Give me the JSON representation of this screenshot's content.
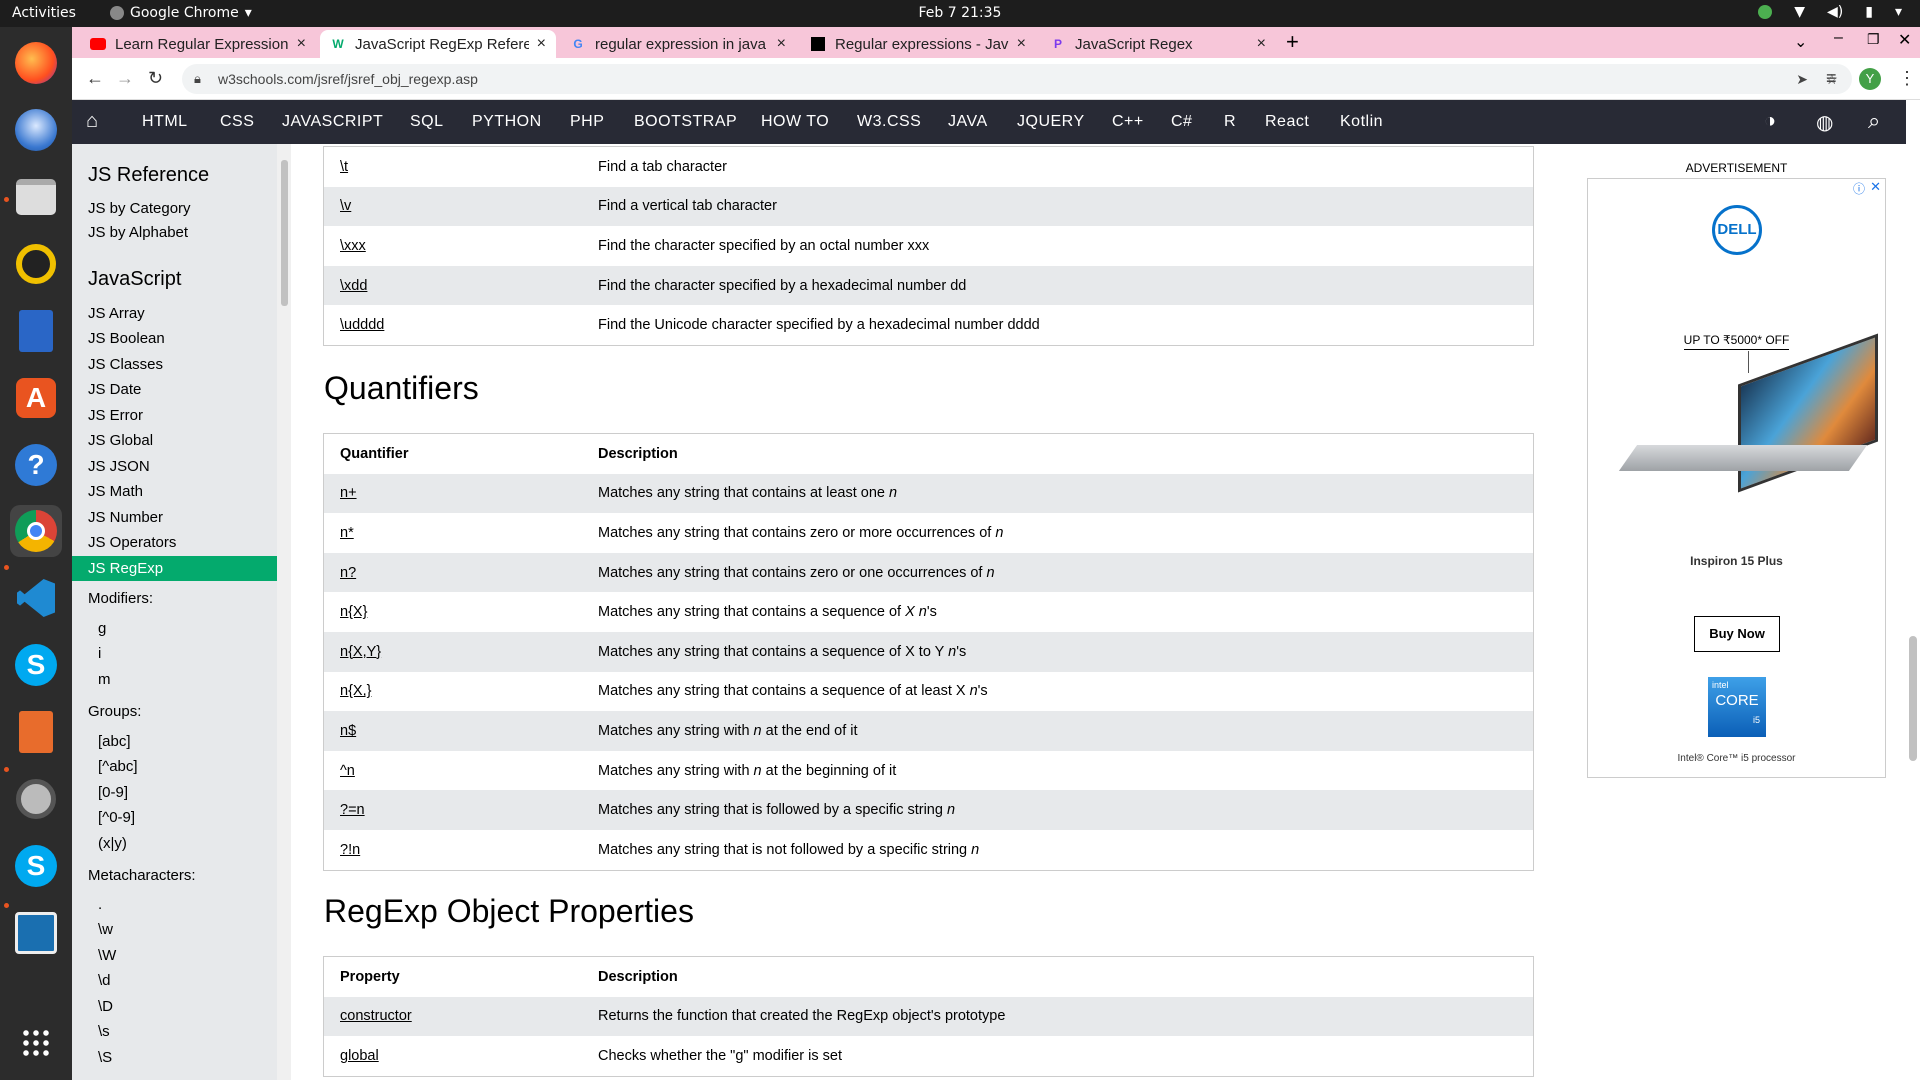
{
  "system": {
    "activities": "Activities",
    "app_name": "Google Chrome",
    "clock": "Feb 7  21:35"
  },
  "tabs": [
    {
      "label": "Learn Regular Expression",
      "icon": "youtube-icon",
      "color": "#ff0000"
    },
    {
      "label": "JavaScript RegExp Refere",
      "icon": "w3schools-icon",
      "color": "#04aa6d"
    },
    {
      "label": "regular expression in java",
      "icon": "google-icon",
      "color": "#4285f4"
    },
    {
      "label": "Regular expressions - Jav",
      "icon": "mdn-icon",
      "color": "#000000"
    },
    {
      "label": "JavaScript Regex",
      "icon": "programiz-icon",
      "color": "#7c3aed"
    }
  ],
  "address": {
    "url": "w3schools.com/jsref/jsref_obj_regexp.asp"
  },
  "w3nav": [
    "HTML",
    "CSS",
    "JAVASCRIPT",
    "SQL",
    "PYTHON",
    "PHP",
    "BOOTSTRAP",
    "HOW TO",
    "W3.CSS",
    "JAVA",
    "JQUERY",
    "C++",
    "C#",
    "R",
    "React",
    "Kotlin"
  ],
  "sidebar": {
    "ref_title": "JS Reference",
    "by_category": "JS by Category",
    "by_alphabet": "JS by Alphabet",
    "js_title": "JavaScript",
    "items": [
      "JS Array",
      "JS Boolean",
      "JS Classes",
      "JS Date",
      "JS Error",
      "JS Global",
      "JS JSON",
      "JS Math",
      "JS Number",
      "JS Operators"
    ],
    "active": "JS RegExp",
    "modifiers_title": "Modifiers:",
    "modifiers": [
      "g",
      "i",
      "m"
    ],
    "groups_title": "Groups:",
    "groups": [
      "[abc]",
      "[^abc]",
      "[0-9]",
      "[^0-9]",
      "(x|y)"
    ],
    "meta_title": "Metacharacters:",
    "meta": [
      ".",
      "\\w",
      "\\W",
      "\\d",
      "\\D",
      "\\s",
      "\\S"
    ]
  },
  "meta_table": [
    {
      "code": "\\t",
      "desc": "Find a tab character"
    },
    {
      "code": "\\v",
      "desc": "Find a vertical tab character"
    },
    {
      "code": "\\xxx",
      "desc": "Find the character specified by an octal number xxx"
    },
    {
      "code": "\\xdd",
      "desc": "Find the character specified by a hexadecimal number dd"
    },
    {
      "code": "\\udddd",
      "desc": "Find the Unicode character specified by a hexadecimal number dddd"
    }
  ],
  "quantifiers": {
    "heading": "Quantifiers",
    "col1": "Quantifier",
    "col2": "Description",
    "rows": [
      {
        "code": "n+",
        "desc": "Matches any string that contains at least one ",
        "em": "n",
        "tail": ""
      },
      {
        "code": "n*",
        "desc": "Matches any string that contains zero or more occurrences of ",
        "em": "n",
        "tail": ""
      },
      {
        "code": "n?",
        "desc": "Matches any string that contains zero or one occurrences of ",
        "em": "n",
        "tail": ""
      },
      {
        "code": "n{X}",
        "desc": "Matches any string that contains a sequence of ",
        "em": "X n",
        "tail": "'s"
      },
      {
        "code": "n{X,Y}",
        "desc": "Matches any string that contains a sequence of X to Y ",
        "em": "n",
        "tail": "'s"
      },
      {
        "code": "n{X,}",
        "desc": "Matches any string that contains a sequence of at least X ",
        "em": "n",
        "tail": "'s"
      },
      {
        "code": "n$",
        "desc": "Matches any string with ",
        "em": "n",
        "tail": " at the end of it"
      },
      {
        "code": "^n",
        "desc": "Matches any string with ",
        "em": "n",
        "tail": " at the beginning of it"
      },
      {
        "code": "?=n",
        "desc": "Matches any string that is followed by a specific string ",
        "em": "n",
        "tail": ""
      },
      {
        "code": "?!n",
        "desc": "Matches any string that is not followed by a specific string ",
        "em": "n",
        "tail": ""
      }
    ]
  },
  "properties": {
    "heading": "RegExp Object Properties",
    "col1": "Property",
    "col2": "Description",
    "rows": [
      {
        "code": "constructor",
        "desc": "Returns the function that created the RegExp object's prototype"
      },
      {
        "code": "global",
        "desc": "Checks whether the \"g\" modifier is set"
      }
    ]
  },
  "ad": {
    "label": "ADVERTISEMENT",
    "brand": "DELL",
    "offer": "UP TO ₹5000* OFF",
    "product": "Inspiron 15 Plus",
    "cta": "Buy Now",
    "chip_line1": "intel",
    "chip_line2": "CORE",
    "chip_line3": "i5",
    "footnote": "Intel® Core™ i5 processor"
  },
  "colors": {
    "w3_green": "#04aa6d",
    "w3_nav": "#282a35",
    "tabbar": "#f7c6d9"
  }
}
